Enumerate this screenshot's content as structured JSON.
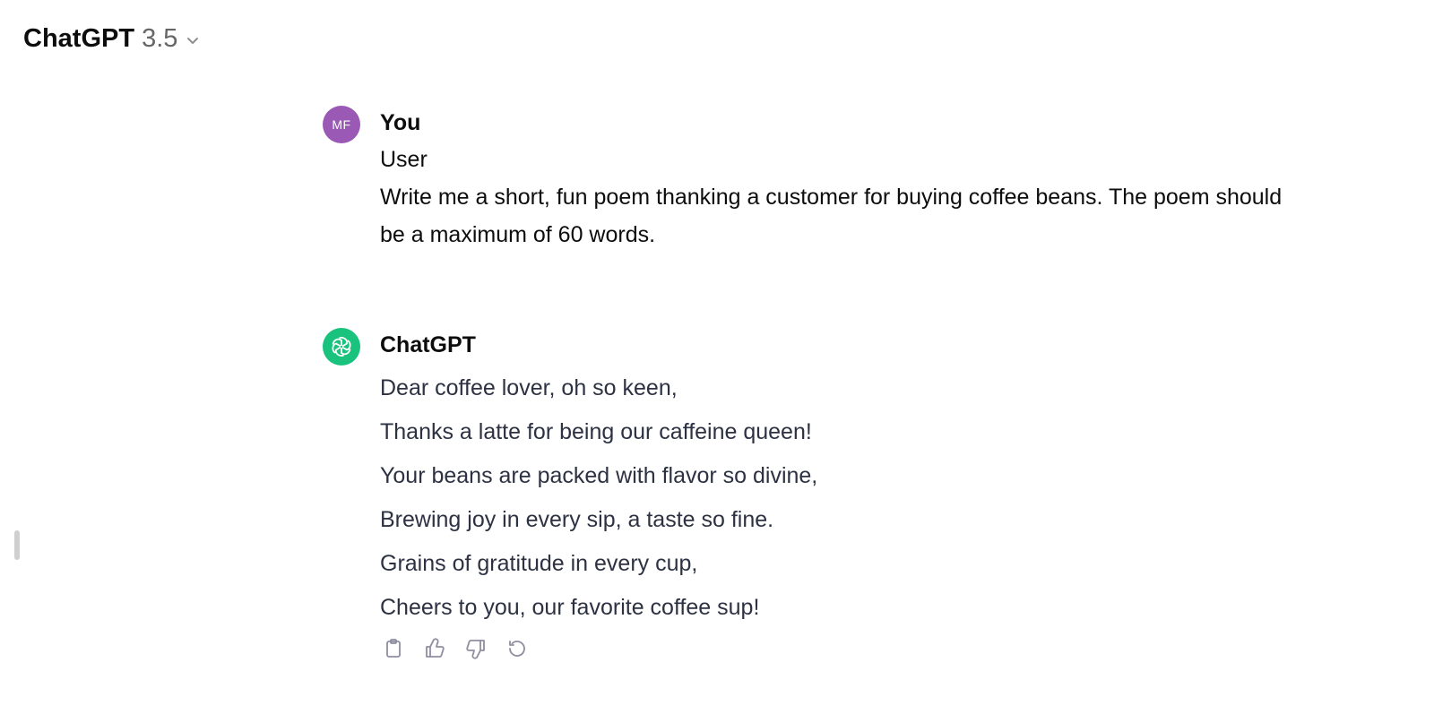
{
  "header": {
    "model_name": "ChatGPT",
    "model_version": "3.5"
  },
  "messages": [
    {
      "author": "You",
      "avatar_initials": "MF",
      "avatar_color": "#9b59b6",
      "lines": [
        "User",
        "Write me a short, fun poem thanking a customer for buying coffee beans. The poem should be a maximum of 60 words."
      ]
    },
    {
      "author": "ChatGPT",
      "avatar_color": "#19c37d",
      "poem": [
        "Dear coffee lover, oh so keen,",
        "Thanks a latte for being our caffeine queen!",
        "Your beans are packed with flavor so divine,",
        "Brewing joy in every sip, a taste so fine.",
        "Grains of gratitude in every cup,",
        "Cheers to you, our favorite coffee sup!"
      ],
      "actions": [
        "clipboard-icon",
        "thumbs-up-icon",
        "thumbs-down-icon",
        "regenerate-icon"
      ]
    }
  ]
}
